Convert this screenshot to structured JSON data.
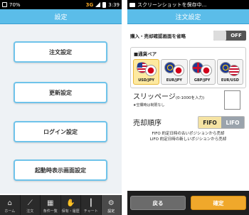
{
  "left": {
    "status": {
      "time": "3:39",
      "network": "3G",
      "left_text": "70%"
    },
    "title": "設定",
    "menu": [
      {
        "label": "注文設定"
      },
      {
        "label": "更新設定"
      },
      {
        "label": "ログイン設定"
      },
      {
        "label": "起動時表示画面設定"
      }
    ],
    "tabs": [
      {
        "label": "ホーム",
        "icon": "house-icon",
        "glyph": "⌂"
      },
      {
        "label": "注文",
        "icon": "chart-line-icon",
        "glyph": "⟋"
      },
      {
        "label": "条件一覧",
        "icon": "table-icon",
        "glyph": "▦"
      },
      {
        "label": "保有・履歴",
        "icon": "handshake-icon",
        "glyph": "✋"
      },
      {
        "label": "チャート",
        "icon": "candle-chart-icon",
        "glyph": "┃"
      },
      {
        "label": "設定",
        "icon": "gear-icon",
        "glyph": "⚙"
      }
    ]
  },
  "right": {
    "status": {
      "text": "スクリーンショットを保存中..."
    },
    "title": "注文設定",
    "confirm_skip": {
      "label": "購入・売却確認画面を省略",
      "value": "OFF"
    },
    "pairs_panel": {
      "heading": "■通貨ペア",
      "pairs": [
        {
          "code": "USD/JPY",
          "selected": true,
          "flag_a": "us-flag-icon",
          "flag_b": "jp-flag-icon"
        },
        {
          "code": "EUR/JPY",
          "selected": false,
          "flag_a": "eu-flag-icon",
          "flag_b": "jp-flag-icon"
        },
        {
          "code": "GBP/JPY",
          "selected": false,
          "flag_a": "uk-flag-icon",
          "flag_b": "jp-flag-icon"
        },
        {
          "code": "EUR/USD",
          "selected": false,
          "flag_a": "eu-flag-icon",
          "flag_b": "us-flag-icon"
        }
      ]
    },
    "slippage": {
      "title": "スリッページ",
      "hint": "(0-1000を入力)",
      "note": "★空欄時は制限なし",
      "value": ""
    },
    "sell_order": {
      "title": "売却順序",
      "options": [
        "FIFO",
        "LIFO"
      ],
      "selected": "FIFO",
      "desc_1": "FIFO 約定日時の古いポジションから売却",
      "desc_2": "LIFO 約定日時の新しいポジションから売却"
    },
    "footer": {
      "back": "戻る",
      "ok": "確定"
    }
  },
  "colors": {
    "title_bar": "#5bbde9",
    "button_border": "#6fc3ea",
    "ok_button": "#f0a82b",
    "selected_pair": "#fde9a0"
  }
}
